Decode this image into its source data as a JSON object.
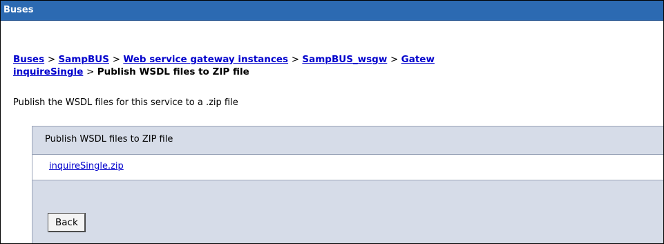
{
  "window": {
    "title": "Buses"
  },
  "breadcrumb": {
    "items": [
      {
        "label": "Buses",
        "link": true
      },
      {
        "label": "SampBUS",
        "link": true
      },
      {
        "label": "Web service gateway instances",
        "link": true
      },
      {
        "label": "SampBUS_wsgw",
        "link": true
      },
      {
        "label": "Gatew",
        "link": true
      },
      {
        "label": "inquireSingle",
        "link": true
      },
      {
        "label": "Publish WSDL files to ZIP file",
        "link": false
      }
    ],
    "separator": ">"
  },
  "description": "Publish the WSDL files for this service to a .zip file",
  "panel": {
    "header": "Publish WSDL files to ZIP file",
    "file_link": "inquireSingle.zip",
    "back_button": "Back"
  },
  "colors": {
    "title_bar": "#2c6ab2",
    "link": "#0000cc",
    "panel_bg": "#d6dce8"
  }
}
